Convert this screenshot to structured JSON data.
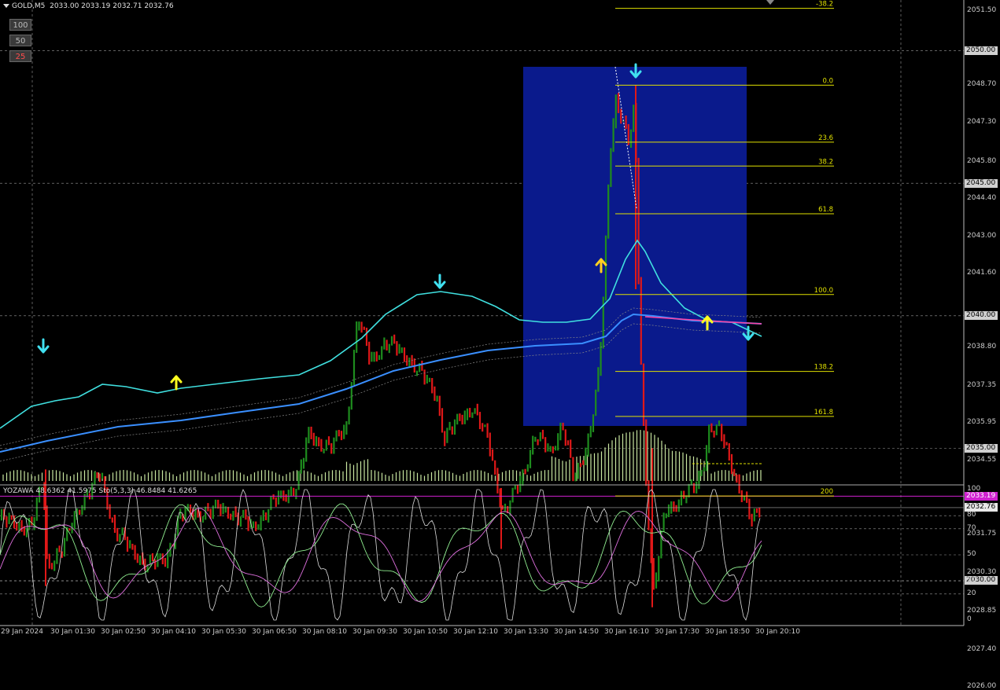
{
  "header": {
    "symbol": "GOLD,M5",
    "ohlc": "2033.00 2033.19 2032.71 2032.76"
  },
  "zoom_buttons": [
    {
      "label": "100",
      "color": "#bbbbbb"
    },
    {
      "label": "50",
      "color": "#bbbbbb"
    },
    {
      "label": "25",
      "color": "#ff4d4d"
    }
  ],
  "indicator_header": "YOZAWA 48.6362 41.5975  Sto(5,3,3) 46.8484 41.6265",
  "price_axis": [
    {
      "label": "2051.50",
      "price": 2051.5
    },
    {
      "label": "2048.70",
      "price": 2048.7
    },
    {
      "label": "2047.30",
      "price": 2047.3
    },
    {
      "label": "2045.80",
      "price": 2045.8
    },
    {
      "label": "2044.40",
      "price": 2044.4
    },
    {
      "label": "2043.00",
      "price": 2043.0
    },
    {
      "label": "2041.60",
      "price": 2041.6
    },
    {
      "label": "2038.80",
      "price": 2038.8
    },
    {
      "label": "2037.35",
      "price": 2037.35
    },
    {
      "label": "2035.95",
      "price": 2035.95
    },
    {
      "label": "2034.55",
      "price": 2034.55
    },
    {
      "label": "2031.75",
      "price": 2031.75
    },
    {
      "label": "2030.30",
      "price": 2030.3
    },
    {
      "label": "2028.85",
      "price": 2028.85
    },
    {
      "label": "2027.40",
      "price": 2027.4
    },
    {
      "label": "2026.00",
      "price": 2026.0
    }
  ],
  "price_boxes": [
    {
      "label": "2050.00",
      "price": 2050.0,
      "bg": "#d0d0d0",
      "fg": "#000000"
    },
    {
      "label": "2045.00",
      "price": 2045.0,
      "bg": "#d0d0d0",
      "fg": "#000000"
    },
    {
      "label": "2040.00",
      "price": 2040.0,
      "bg": "#d0d0d0",
      "fg": "#000000"
    },
    {
      "label": "2035.00",
      "price": 2035.0,
      "bg": "#d0d0d0",
      "fg": "#000000"
    },
    {
      "label": "2033.19",
      "price": 2033.19,
      "bg": "#d020d0",
      "fg": "#ffffff"
    },
    {
      "label": "2032.76",
      "price": 2032.76,
      "bg": "#e8e8e8",
      "fg": "#000000"
    },
    {
      "label": "2030.00",
      "price": 2030.0,
      "bg": "#d0d0d0",
      "fg": "#000000"
    }
  ],
  "time_axis": [
    "29 Jan 2024",
    "30 Jan 01:30",
    "30 Jan 02:50",
    "30 Jan 04:10",
    "30 Jan 05:30",
    "30 Jan 06:50",
    "30 Jan 08:10",
    "30 Jan 09:30",
    "30 Jan 10:50",
    "30 Jan 12:10",
    "30 Jan 13:30",
    "30 Jan 14:50",
    "30 Jan 16:10",
    "30 Jan 17:30",
    "30 Jan 18:50",
    "30 Jan 20:10"
  ],
  "fib_levels": [
    {
      "label": "-38.2",
      "price": 2051.6
    },
    {
      "label": "0.0",
      "price": 2048.7
    },
    {
      "label": "23.6",
      "price": 2046.55
    },
    {
      "label": "38.2",
      "price": 2045.65
    },
    {
      "label": "61.8",
      "price": 2043.85
    },
    {
      "label": "100.0",
      "price": 2040.8
    },
    {
      "label": "138.2",
      "price": 2037.9
    },
    {
      "label": "161.8",
      "price": 2036.2
    },
    {
      "label": "200",
      "price": 2033.2
    }
  ],
  "sub_axis": [
    {
      "label": "100",
      "value": 100
    },
    {
      "label": "80",
      "value": 80
    },
    {
      "label": "70",
      "value": 70
    },
    {
      "label": "50",
      "value": 50
    },
    {
      "label": "30",
      "value": 30
    },
    {
      "label": "20",
      "value": 20
    },
    {
      "label": "0",
      "value": 0
    }
  ],
  "colors": {
    "bull": "#1e8c1e",
    "bear": "#e01818",
    "fib": "#e0e000",
    "ma_fast": "#40e0e0",
    "ma_slow": "#3a8fff",
    "box": "#0a1a8c",
    "magenta": "#d020d0",
    "stoch_main": "#90ee90",
    "stoch_signal": "#e070e0",
    "yozawa": "#dddddd",
    "volume": "#c8e6a0"
  }
}
